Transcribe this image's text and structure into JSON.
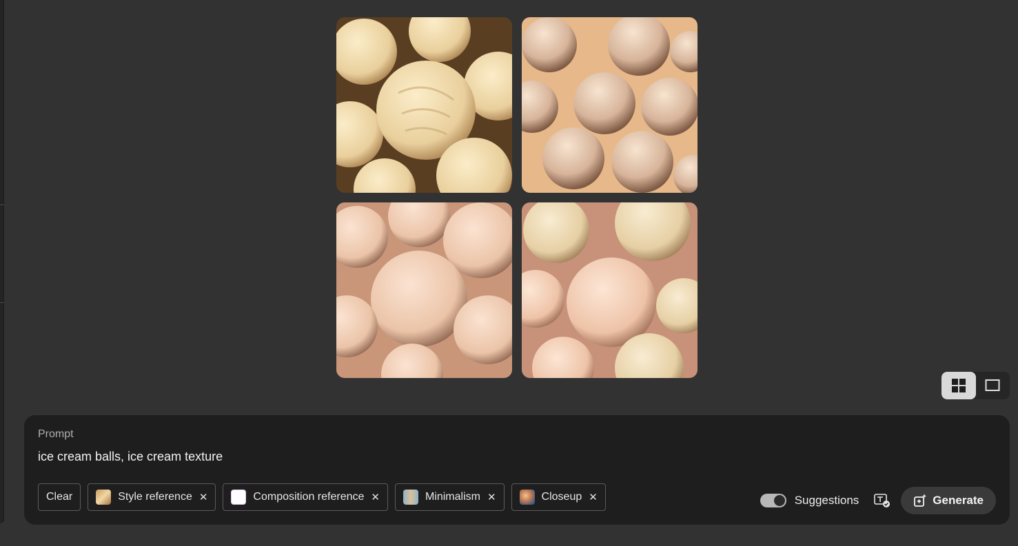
{
  "gallery": {
    "images": [
      {
        "name": "generated-image-1",
        "tint": "#efd7a8"
      },
      {
        "name": "generated-image-2",
        "tint": "#d9b9a0"
      },
      {
        "name": "generated-image-3",
        "tint": "#f0cdb6"
      },
      {
        "name": "generated-image-4",
        "tint": "#efc8ae"
      }
    ]
  },
  "view_toggle": {
    "grid_icon": "grid-view-icon",
    "single_icon": "single-view-icon",
    "active": "grid"
  },
  "prompt": {
    "label": "Prompt",
    "text": "ice cream balls, ice cream texture"
  },
  "chips": {
    "clear_label": "Clear",
    "style_reference": "Style reference",
    "composition_reference": "Composition reference",
    "minimalism": "Minimalism",
    "closeup": "Closeup"
  },
  "controls": {
    "suggestions_label": "Suggestions",
    "suggestions_on": true,
    "generate_label": "Generate"
  },
  "colors": {
    "background": "#323232",
    "panel": "#1e1e1e",
    "chip_border": "#5c5c5c"
  }
}
